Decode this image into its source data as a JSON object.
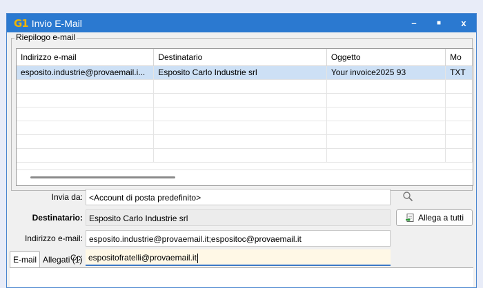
{
  "window": {
    "app_icon_glyph": "G1",
    "title": "Invio E-Mail",
    "minimize_glyph": "–",
    "maximize_glyph": "■",
    "close_glyph": "x"
  },
  "summary": {
    "legend": "Riepilogo e-mail",
    "columns": [
      "Indirizzo e-mail",
      "Destinatario",
      "Oggetto",
      "Mo"
    ],
    "rows": [
      [
        "esposito.industrie@provaemail.i...",
        "Esposito Carlo Industrie srl",
        "Your invoice2025 93",
        "TXT"
      ]
    ]
  },
  "form": {
    "send_from": {
      "label": "Invia da:",
      "value": "<Account di posta predefinito>"
    },
    "recipient": {
      "label": "Destinatario:",
      "value": "Esposito Carlo Industrie srl"
    },
    "email_address": {
      "label": "Indirizzo e-mail:",
      "value": "esposito.industrie@provaemail.it;espositoc@provaemail.it"
    },
    "cc": {
      "label": "Cc:",
      "value": "espositofratelli@provaemail.it"
    },
    "search_icon": "magnifier-icon",
    "attach_all": "Allega a tutti"
  },
  "tabs": [
    "E-mail",
    "Allegati (1)"
  ],
  "colors": {
    "titlebar": "#2b79d0",
    "selected_row": "#cde0f5",
    "focus_field": "#fff8e6"
  }
}
